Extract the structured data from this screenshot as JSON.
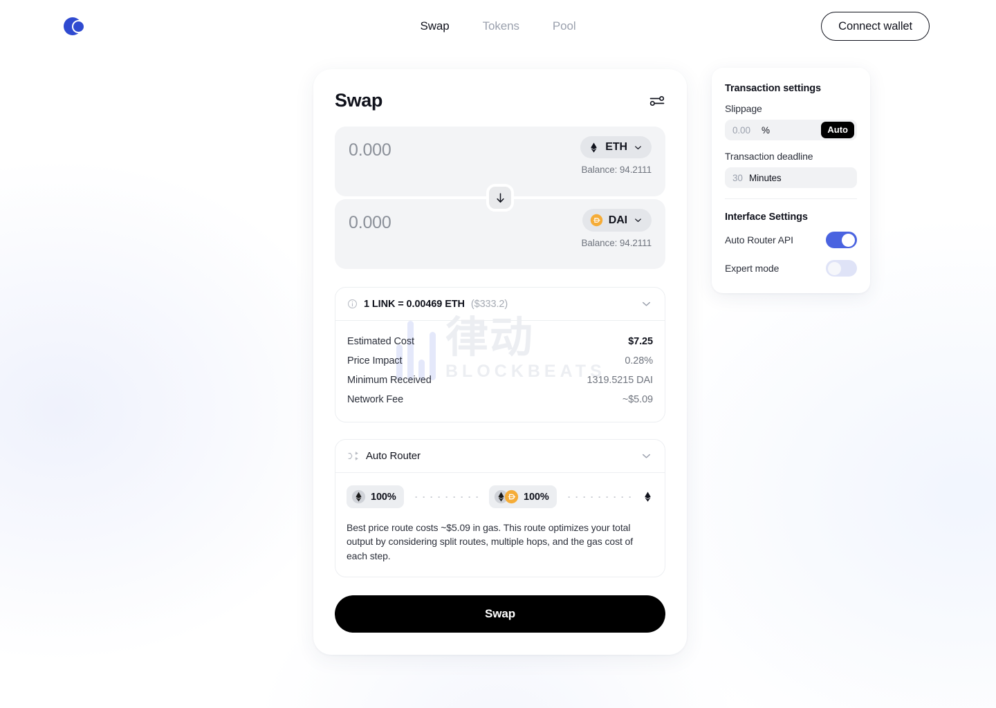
{
  "brand": {
    "logo_icon": "overlapping-circles-logo",
    "accent": "#2f4ad0"
  },
  "nav": {
    "items": [
      {
        "label": "Swap",
        "active": true
      },
      {
        "label": "Tokens",
        "active": false
      },
      {
        "label": "Pool",
        "active": false
      }
    ],
    "connect_wallet": "Connect wallet"
  },
  "swap": {
    "title": "Swap",
    "settings_icon": "sliders-icon",
    "from": {
      "amount_placeholder": "0.000",
      "amount_value": "",
      "token": "ETH",
      "token_icon": "ethereum-icon",
      "balance": "Balance: 94.2111",
      "chevron_icon": "chevron-down-icon"
    },
    "to": {
      "amount_placeholder": "0.000",
      "amount_value": "",
      "token": "DAI",
      "token_icon": "dai-icon",
      "balance": "Balance: 94.2111",
      "chevron_icon": "chevron-down-icon"
    },
    "switch_icon": "arrow-down-icon",
    "rate": {
      "info_icon": "info-icon",
      "text": "1 LINK = 0.00469 ETH",
      "usd": "($333.2)",
      "chevron_icon": "chevron-down-icon"
    },
    "details": [
      {
        "label": "Estimated Cost",
        "value": "$7.25",
        "strong": true
      },
      {
        "label": "Price Impact",
        "value": "0.28%",
        "strong": false
      },
      {
        "label": "Minimum Received",
        "value": "1319.5215 DAI",
        "strong": false
      },
      {
        "label": "Network Fee",
        "value": "~$5.09",
        "strong": false
      }
    ],
    "router": {
      "icon": "shuffle-icon",
      "title": "Auto Router",
      "chevron_icon": "chevron-down-icon",
      "hops": [
        {
          "percent": "100%",
          "tokens": [
            "ethereum-icon"
          ]
        },
        {
          "percent": "100%",
          "tokens": [
            "ethereum-icon",
            "dai-icon"
          ]
        }
      ],
      "end_icon": "ethereum-icon",
      "note": "Best price route costs ~$5.09 in gas. This route optimizes your total output by considering split routes, multiple hops, and the gas cost of each step."
    },
    "action_button": "Swap"
  },
  "settings": {
    "transaction_title": "Transaction settings",
    "slippage_label": "Slippage",
    "slippage_placeholder": "0.00",
    "slippage_value": "",
    "slippage_unit": "%",
    "auto_badge": "Auto",
    "deadline_label": "Transaction deadline",
    "deadline_placeholder": "30",
    "deadline_value": "",
    "deadline_unit": "Minutes",
    "interface_title": "Interface Settings",
    "toggles": [
      {
        "label": "Auto Router API",
        "on": true
      },
      {
        "label": "Expert mode",
        "on": false
      }
    ]
  },
  "watermark": {
    "cn": "律动",
    "en": "BLOCKBEATS"
  }
}
